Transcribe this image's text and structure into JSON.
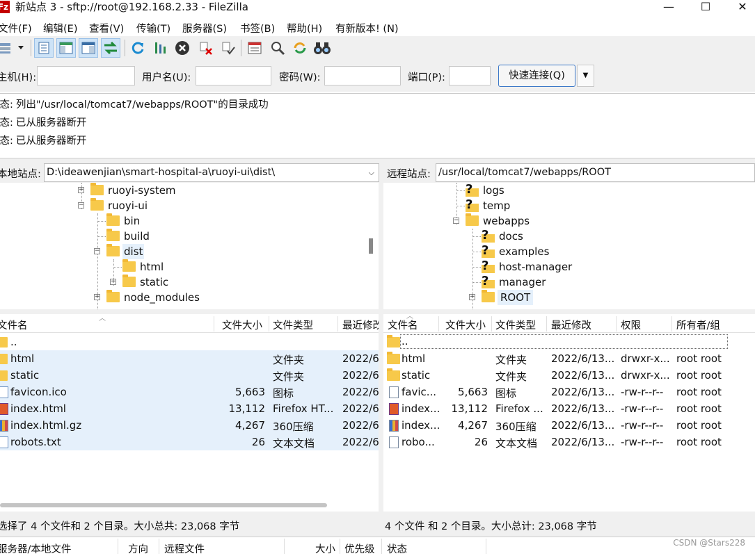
{
  "window": {
    "title": "新站点 3 - sftp://root@192.168.2.33 - FileZilla",
    "app_icon": "Fz",
    "minimize": "—",
    "maximize": "☐",
    "close": "✕"
  },
  "menu": [
    "文件(F)",
    "编辑(E)",
    "查看(V)",
    "传输(T)",
    "服务器(S)",
    "书签(B)",
    "帮助(H)",
    "有新版本! (N)"
  ],
  "quickconnect": {
    "host_label": "主机(H):",
    "host_value": "",
    "user_label": "用户名(U):",
    "user_value": "",
    "pass_label": "密码(W):",
    "pass_value": "",
    "port_label": "端口(P):",
    "port_value": "",
    "connect_label": "快速连接(Q)",
    "dropdown_glyph": "▼"
  },
  "log": [
    {
      "prefix": "状态:",
      "text": "列出\"/usr/local/tomcat7/webapps/ROOT\"的目录成功"
    },
    {
      "prefix": "状态:",
      "text": "已从服务器断开"
    },
    {
      "prefix": "状态:",
      "text": "已从服务器断开"
    }
  ],
  "local": {
    "path_label": "本地站点:",
    "path": "D:\\ideawenjian\\smart-hospital-a\\ruoyi-ui\\dist\\",
    "tree": [
      {
        "label": "ruoyi-system",
        "expander": "+"
      },
      {
        "label": "ruoyi-ui",
        "expander": "−"
      },
      {
        "label": "bin",
        "expander": ""
      },
      {
        "label": "build",
        "expander": ""
      },
      {
        "label": "dist",
        "expander": "−"
      },
      {
        "label": "html",
        "expander": ""
      },
      {
        "label": "static",
        "expander": "+"
      },
      {
        "label": "node_modules",
        "expander": "+"
      }
    ],
    "columns": [
      "文件名",
      "文件大小",
      "文件类型",
      "最近修改"
    ],
    "files": [
      {
        "name": "..",
        "size": "",
        "type": "",
        "date": ""
      },
      {
        "name": "html",
        "size": "",
        "type": "文件夹",
        "date": "2022/6"
      },
      {
        "name": "static",
        "size": "",
        "type": "文件夹",
        "date": "2022/6"
      },
      {
        "name": "favicon.ico",
        "size": "5,663",
        "type": "图标",
        "date": "2022/6"
      },
      {
        "name": "index.html",
        "size": "13,112",
        "type": "Firefox HT...",
        "date": "2022/6"
      },
      {
        "name": "index.html.gz",
        "size": "4,267",
        "type": "360压缩",
        "date": "2022/6"
      },
      {
        "name": "robots.txt",
        "size": "26",
        "type": "文本文档",
        "date": "2022/6"
      }
    ],
    "status": "选择了 4 个文件和 2 个目录。大小总共: 23,068 字节"
  },
  "remote": {
    "path_label": "远程站点:",
    "path": "/usr/local/tomcat7/webapps/ROOT",
    "tree": [
      {
        "label": "logs",
        "expander": "",
        "unknown": true
      },
      {
        "label": "temp",
        "expander": "",
        "unknown": true
      },
      {
        "label": "webapps",
        "expander": "−",
        "unknown": false
      },
      {
        "label": "docs",
        "expander": "",
        "unknown": true
      },
      {
        "label": "examples",
        "expander": "",
        "unknown": true
      },
      {
        "label": "host-manager",
        "expander": "",
        "unknown": true
      },
      {
        "label": "manager",
        "expander": "",
        "unknown": true
      },
      {
        "label": "ROOT",
        "expander": "+",
        "unknown": false
      }
    ],
    "columns": [
      "文件名",
      "文件大小",
      "文件类型",
      "最近修改",
      "权限",
      "所有者/组"
    ],
    "files": [
      {
        "name": "..",
        "size": "",
        "type": "",
        "date": "",
        "perm": "",
        "owner": ""
      },
      {
        "name": "html",
        "size": "",
        "type": "文件夹",
        "date": "2022/6/13...",
        "perm": "drwxr-x...",
        "owner": "root root"
      },
      {
        "name": "static",
        "size": "",
        "type": "文件夹",
        "date": "2022/6/13...",
        "perm": "drwxr-x...",
        "owner": "root root"
      },
      {
        "name": "favic...",
        "size": "5,663",
        "type": "图标",
        "date": "2022/6/13...",
        "perm": "-rw-r--r--",
        "owner": "root root"
      },
      {
        "name": "index...",
        "size": "13,112",
        "type": "Firefox ...",
        "date": "2022/6/13...",
        "perm": "-rw-r--r--",
        "owner": "root root"
      },
      {
        "name": "index...",
        "size": "4,267",
        "type": "360压缩",
        "date": "2022/6/13...",
        "perm": "-rw-r--r--",
        "owner": "root root"
      },
      {
        "name": "robo...",
        "size": "26",
        "type": "文本文档",
        "date": "2022/6/13...",
        "perm": "-rw-r--r--",
        "owner": "root root"
      }
    ],
    "status": "4 个文件 和 2 个目录。大小总计: 23,068 字节"
  },
  "queue": {
    "columns": [
      "服务器/本地文件",
      "方向",
      "远程文件",
      "大小",
      "优先级",
      "状态"
    ]
  },
  "watermark": "CSDN @Stars228",
  "colors": {
    "selection": "#e5f0fb",
    "folder": "#f7c94a",
    "chrome": "#f0f0f0",
    "connect_border": "#3c78c8"
  }
}
